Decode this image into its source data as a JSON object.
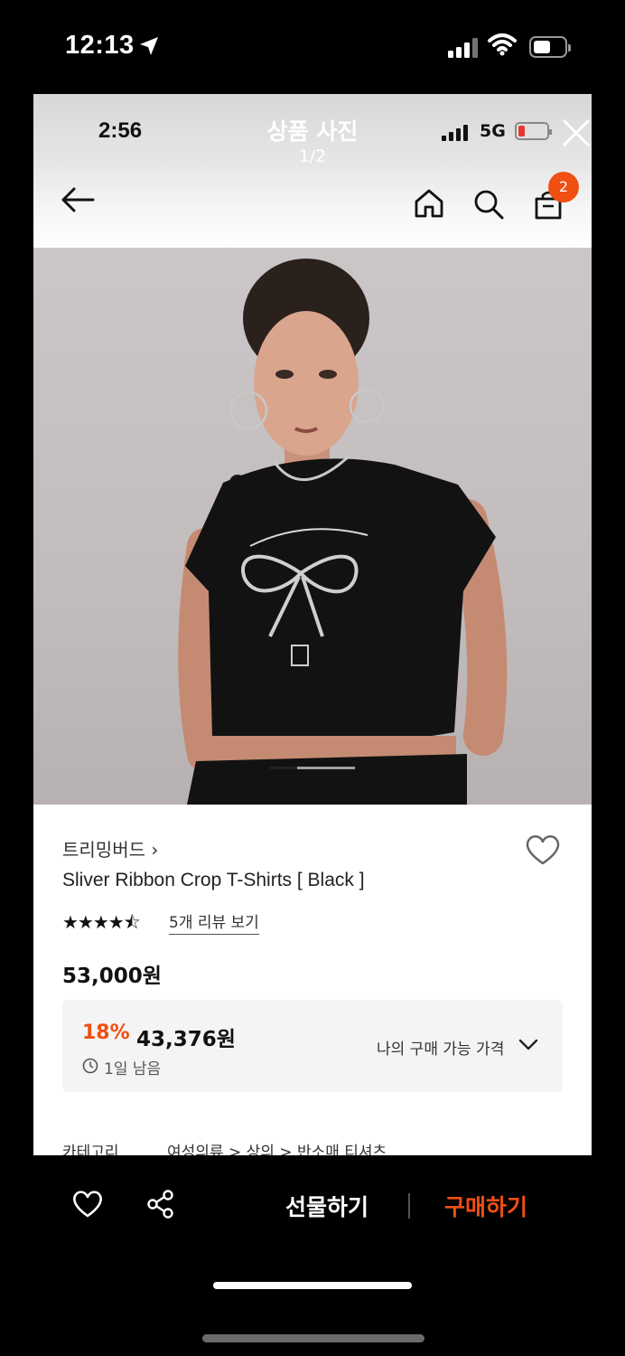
{
  "outer_status": {
    "time": "12:13"
  },
  "inner_status": {
    "time": "2:56",
    "network": "5G"
  },
  "viewer": {
    "title": "상품 사진",
    "counter": "1/2"
  },
  "nav": {
    "cart_count": "2"
  },
  "product": {
    "brand": "트리밍버드 ›",
    "name": "Sliver Ribbon Crop T-Shirts [ Black ]",
    "rating": 4.5,
    "stars": "★★★★⯪",
    "review_link": "5개 리뷰 보기",
    "original_price": "53,000원",
    "discount": "18%",
    "sale_price": "43,376원",
    "time_left": "1일 남음",
    "my_price_label": "나의 구매 가능 가격",
    "category_label": "카테고리",
    "category_path": "여성의류 > 상의 > 반소매 티셔츠"
  },
  "actions": {
    "gift": "선물하기",
    "buy": "구매하기"
  },
  "colors": {
    "accent": "#f04f13",
    "background": "#000000"
  }
}
